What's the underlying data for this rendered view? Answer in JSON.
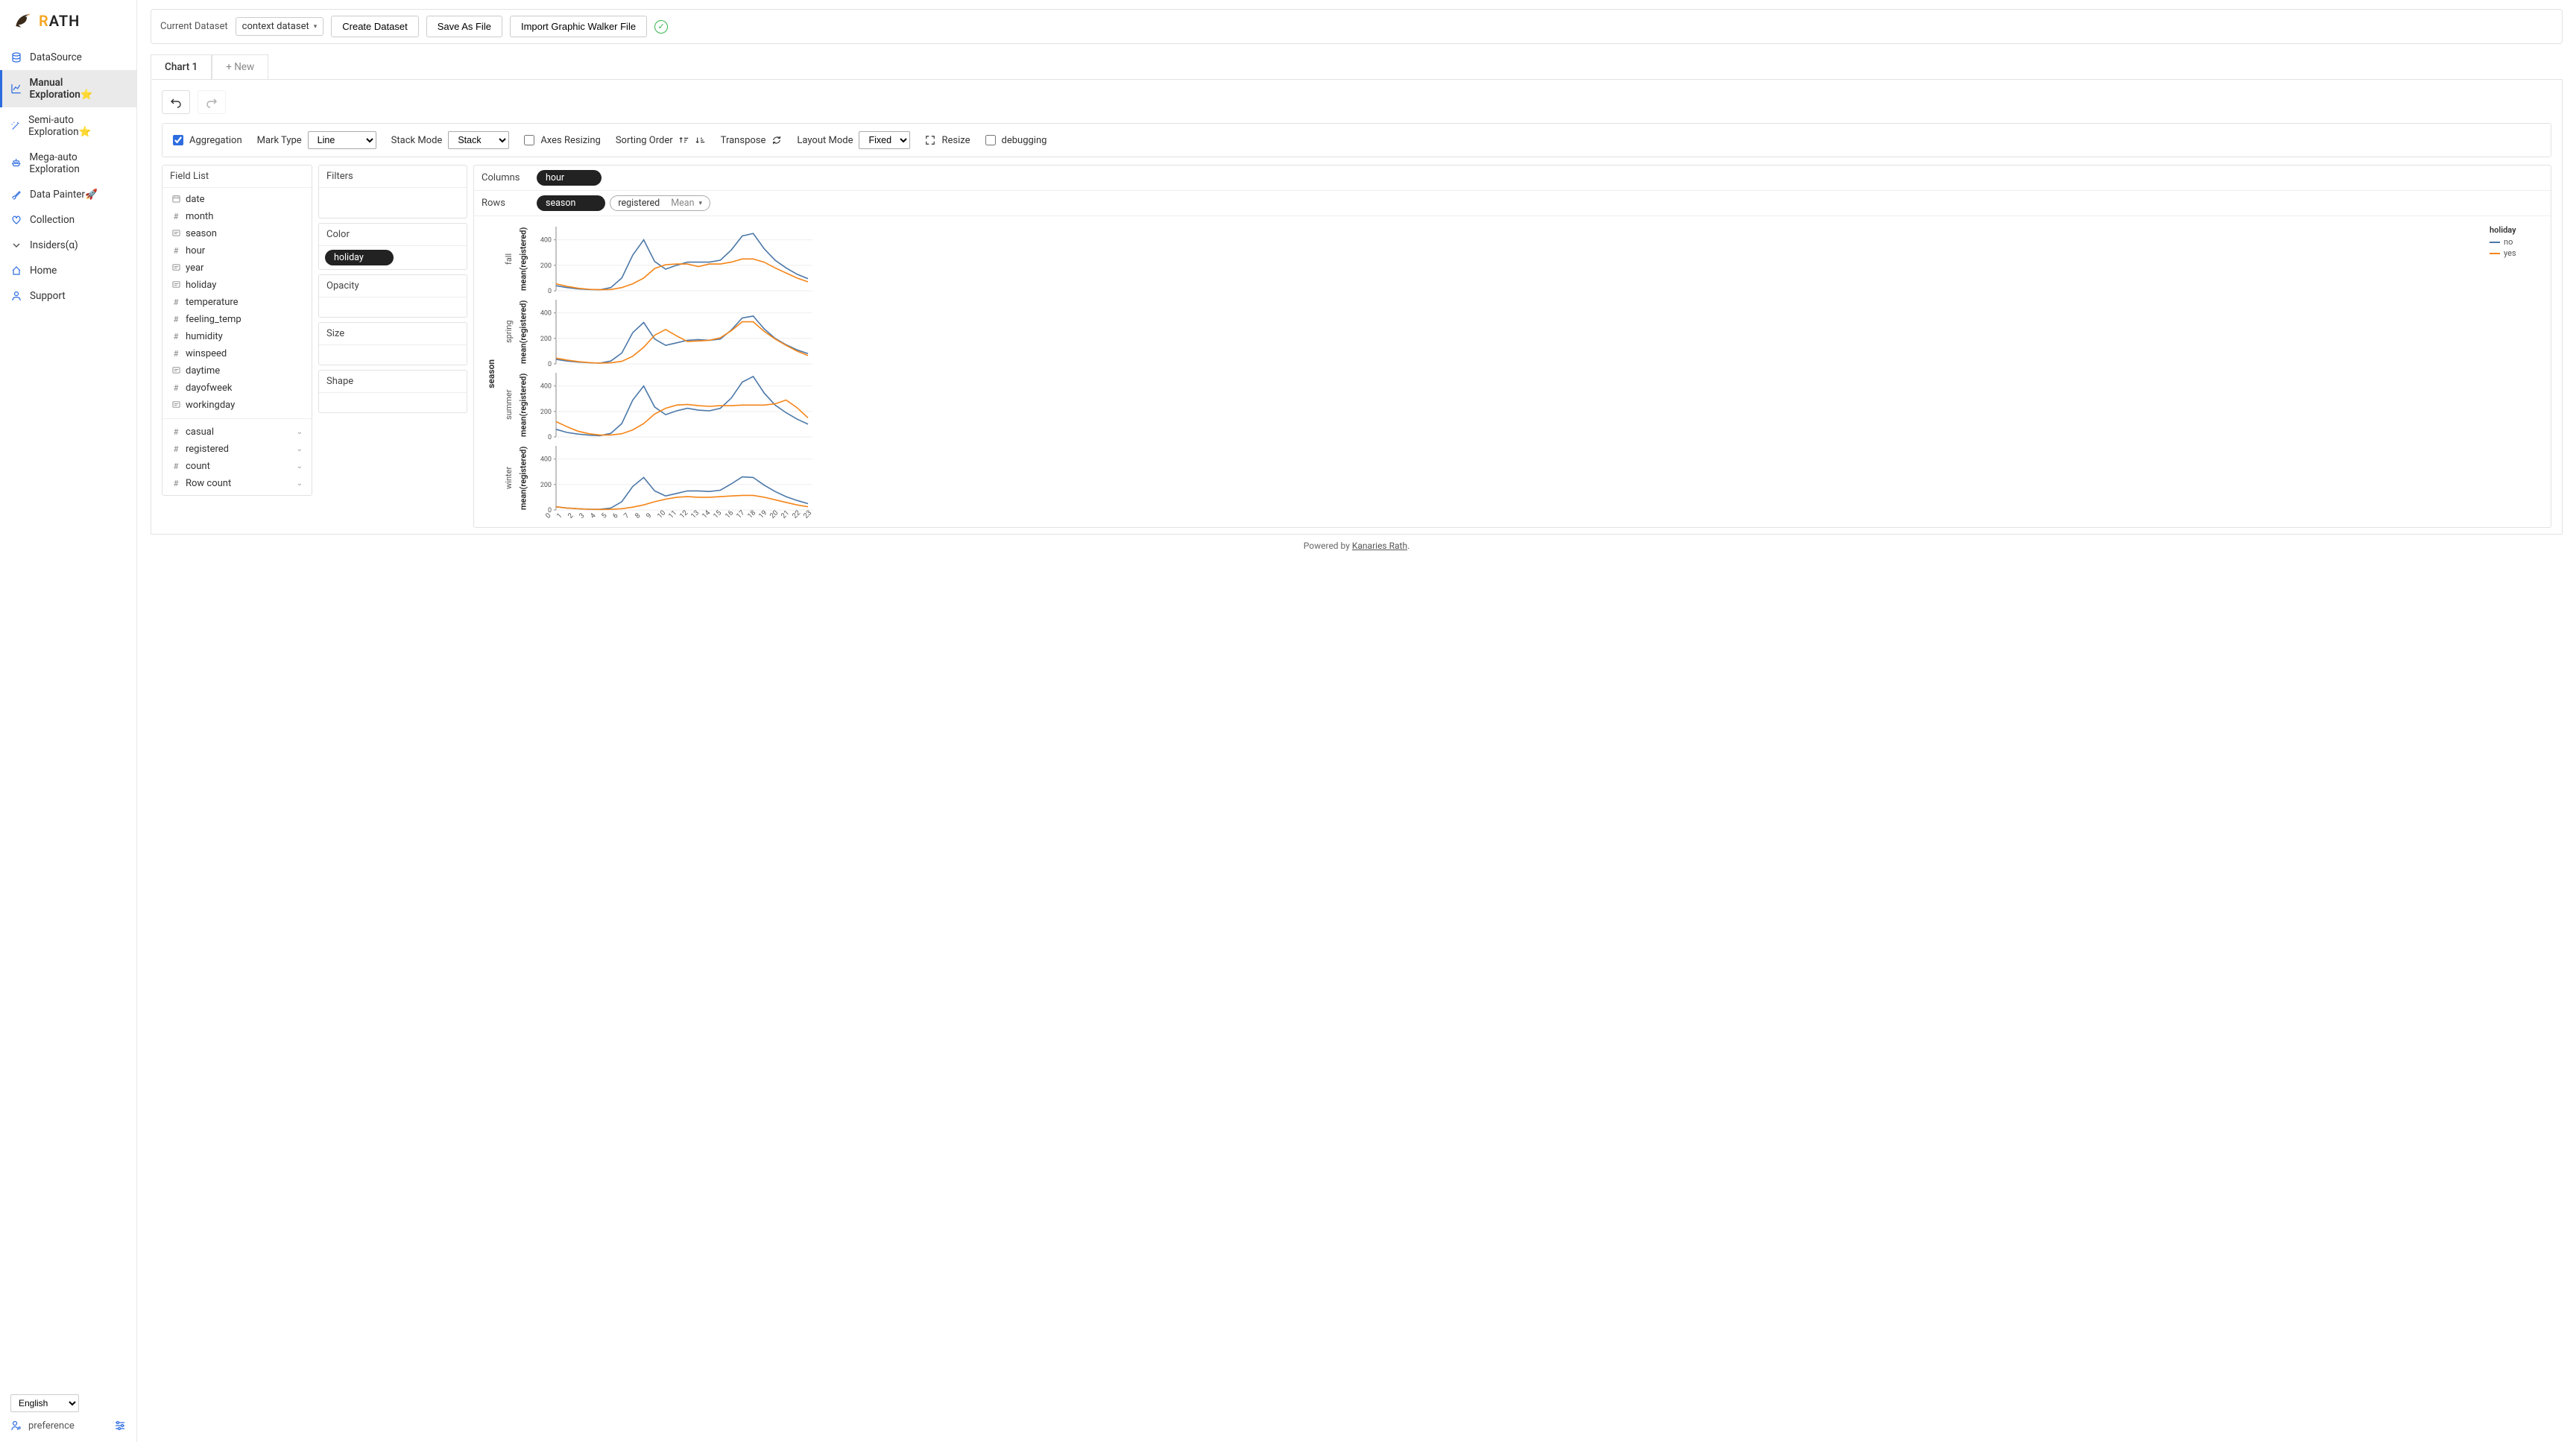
{
  "brand": {
    "name_r": "R",
    "name_ath": "ATH"
  },
  "sidebar": {
    "items": [
      {
        "label": "DataSource",
        "icon": "database-icon"
      },
      {
        "label": "Manual Exploration⭐",
        "icon": "line-chart-icon"
      },
      {
        "label": "Semi-auto Exploration⭐",
        "icon": "wand-icon"
      },
      {
        "label": "Mega-auto Exploration",
        "icon": "robot-icon"
      },
      {
        "label": "Data Painter🚀",
        "icon": "brush-icon"
      },
      {
        "label": "Collection",
        "icon": "heart-icon"
      },
      {
        "label": "Insiders(α)",
        "icon": "chevron-down-icon"
      },
      {
        "label": "Home",
        "icon": "home-icon"
      },
      {
        "label": "Support",
        "icon": "person-icon"
      }
    ],
    "language": "English",
    "preference": "preference"
  },
  "topbar": {
    "current_label": "Current Dataset",
    "current_value": "context dataset",
    "create": "Create Dataset",
    "save": "Save As File",
    "import": "Import Graphic Walker File"
  },
  "tabs": {
    "tab1": "Chart 1",
    "new": "+ New"
  },
  "toolbar": {
    "aggregation": "Aggregation",
    "mark_type_label": "Mark Type",
    "mark_type_value": "Line",
    "stack_mode_label": "Stack Mode",
    "stack_mode_value": "Stack",
    "axes_resizing": "Axes Resizing",
    "sorting_order": "Sorting Order",
    "transpose": "Transpose",
    "layout_mode_label": "Layout Mode",
    "layout_mode_value": "Fixed",
    "resize": "Resize",
    "debugging": "debugging"
  },
  "fieldlist": {
    "header": "Field List",
    "dims": [
      {
        "t": "cal",
        "name": "date"
      },
      {
        "t": "#",
        "name": "month"
      },
      {
        "t": "txt",
        "name": "season"
      },
      {
        "t": "#",
        "name": "hour"
      },
      {
        "t": "txt",
        "name": "year"
      },
      {
        "t": "txt",
        "name": "holiday"
      },
      {
        "t": "#",
        "name": "temperature"
      },
      {
        "t": "#",
        "name": "feeling_temp"
      },
      {
        "t": "#",
        "name": "humidity"
      },
      {
        "t": "#",
        "name": "winspeed"
      },
      {
        "t": "txt",
        "name": "daytime"
      },
      {
        "t": "#",
        "name": "dayofweek"
      },
      {
        "t": "txt",
        "name": "workingday"
      }
    ],
    "meas": [
      {
        "name": "casual"
      },
      {
        "name": "registered"
      },
      {
        "name": "count"
      },
      {
        "name": "Row count"
      }
    ]
  },
  "encodings": {
    "filters": "Filters",
    "color": "Color",
    "color_pill": "holiday",
    "opacity": "Opacity",
    "size": "Size",
    "shape": "Shape"
  },
  "shelves": {
    "columns_label": "Columns",
    "columns_pill": "hour",
    "rows_label": "Rows",
    "rows_pill1": "season",
    "rows_pill2_field": "registered",
    "rows_pill2_agg": "Mean"
  },
  "legend": {
    "title": "holiday",
    "no": "no",
    "yes": "yes"
  },
  "colors": {
    "no": "#4c78a8",
    "yes": "#f58518"
  },
  "ylabel": "mean(registered)",
  "season_axis_label": "season",
  "footer": {
    "prefix": "Powered by ",
    "link": "Kanaries Rath"
  },
  "chart_data": {
    "type": "line",
    "facet_by": "season",
    "x": [
      0,
      1,
      2,
      3,
      4,
      5,
      6,
      7,
      8,
      9,
      10,
      11,
      12,
      13,
      14,
      15,
      16,
      17,
      18,
      19,
      20,
      21,
      22,
      23
    ],
    "xlabel": "hour",
    "ylabel": "mean(registered)",
    "color_by": "holiday",
    "facets": [
      {
        "season": "fall",
        "ylim": [
          0,
          400
        ],
        "series": [
          {
            "name": "no",
            "values": [
              40,
              25,
              15,
              10,
              8,
              25,
              100,
              280,
              400,
              230,
              170,
              200,
              225,
              225,
              225,
              240,
              320,
              430,
              450,
              330,
              240,
              180,
              130,
              95
            ]
          },
          {
            "name": "yes",
            "values": [
              55,
              35,
              20,
              12,
              8,
              10,
              25,
              55,
              100,
              175,
              205,
              210,
              210,
              190,
              210,
              210,
              225,
              250,
              250,
              225,
              180,
              140,
              100,
              70
            ]
          }
        ]
      },
      {
        "season": "spring",
        "ylim": [
          0,
          400
        ],
        "series": [
          {
            "name": "no",
            "values": [
              35,
              22,
              14,
              9,
              6,
              22,
              85,
              245,
              325,
              195,
              145,
              165,
              185,
              190,
              185,
              195,
              265,
              360,
              375,
              275,
              200,
              150,
              110,
              80
            ]
          },
          {
            "name": "yes",
            "values": [
              45,
              30,
              18,
              10,
              6,
              8,
              20,
              60,
              130,
              225,
              270,
              220,
              175,
              180,
              185,
              205,
              260,
              330,
              330,
              255,
              195,
              145,
              100,
              65
            ]
          }
        ]
      },
      {
        "season": "summer",
        "ylim": [
          0,
          400
        ],
        "series": [
          {
            "name": "no",
            "values": [
              60,
              35,
              22,
              14,
              10,
              28,
              105,
              290,
              400,
              235,
              175,
              205,
              225,
              210,
              205,
              225,
              305,
              430,
              475,
              345,
              250,
              190,
              140,
              100
            ]
          },
          {
            "name": "yes",
            "values": [
              120,
              80,
              45,
              25,
              15,
              15,
              25,
              55,
              105,
              180,
              225,
              250,
              255,
              245,
              240,
              245,
              245,
              250,
              250,
              250,
              260,
              290,
              230,
              150
            ]
          }
        ]
      },
      {
        "season": "winter",
        "ylim": [
          0,
          400
        ],
        "series": [
          {
            "name": "no",
            "values": [
              25,
              15,
              10,
              6,
              5,
              15,
              65,
              185,
              255,
              150,
              110,
              130,
              150,
              150,
              145,
              155,
              205,
              260,
              255,
              195,
              145,
              105,
              75,
              50
            ]
          },
          {
            "name": "yes",
            "values": [
              25,
              15,
              10,
              6,
              4,
              5,
              10,
              22,
              40,
              65,
              85,
              100,
              105,
              100,
              100,
              105,
              110,
              115,
              115,
              100,
              80,
              60,
              40,
              25
            ]
          }
        ]
      }
    ]
  }
}
